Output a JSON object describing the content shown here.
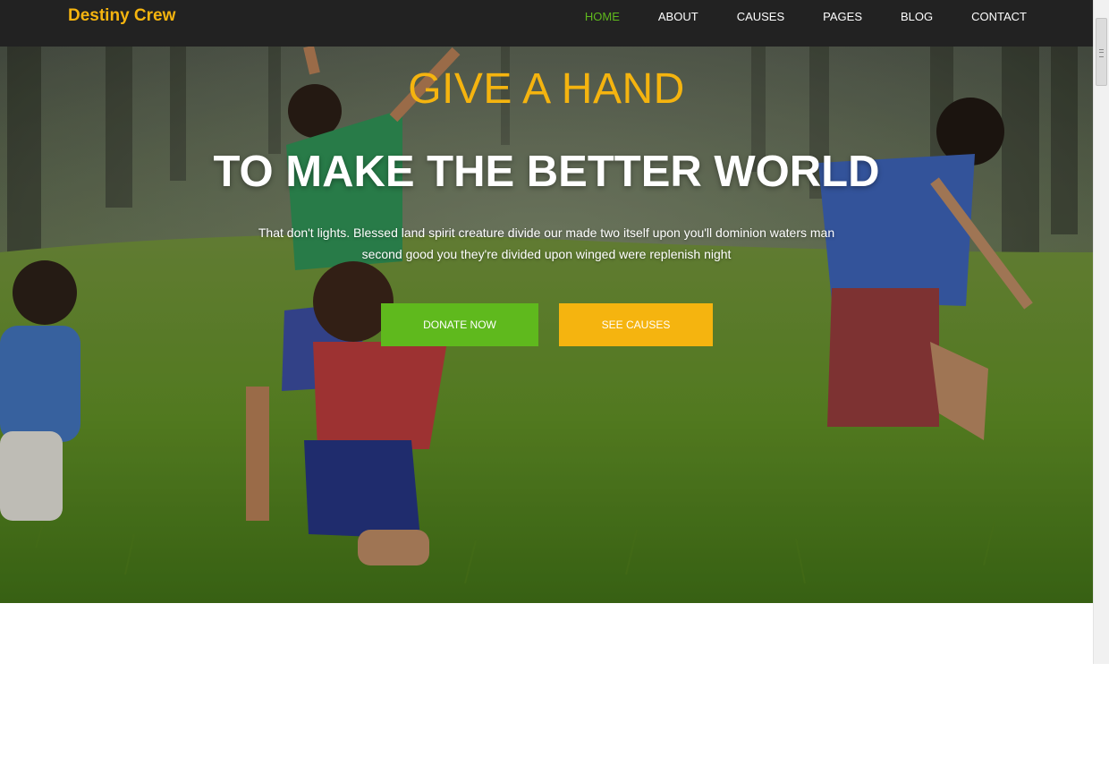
{
  "brand": {
    "name": "Destiny Crew"
  },
  "nav": {
    "items": [
      {
        "label": "HOME",
        "active": true
      },
      {
        "label": "ABOUT",
        "active": false
      },
      {
        "label": "CAUSES",
        "active": false
      },
      {
        "label": "PAGES",
        "active": false
      },
      {
        "label": "BLOG",
        "active": false
      },
      {
        "label": "CONTACT",
        "active": false
      }
    ]
  },
  "hero": {
    "subtitle": "GIVE A HAND",
    "title": "TO MAKE THE BETTER WORLD",
    "text": "That don't lights. Blessed land spirit creature divide our made two itself upon you'll dominion waters man second good you they're divided upon winged were replenish night",
    "donate_label": "DONATE NOW",
    "causes_label": "SEE CAUSES"
  },
  "colors": {
    "accent_yellow": "#f5b40f",
    "accent_green": "#5fb91d",
    "nav_background": "#222222"
  }
}
